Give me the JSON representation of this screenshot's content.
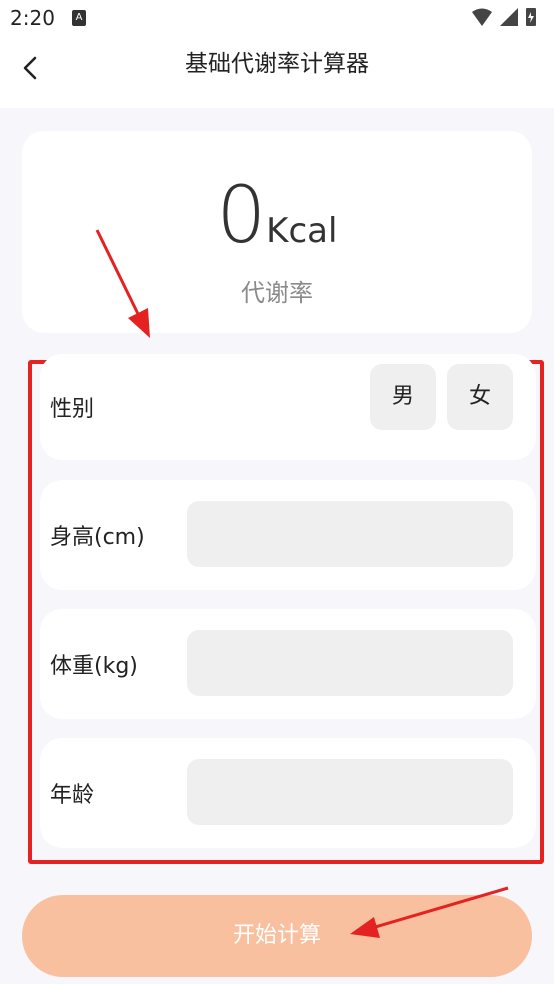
{
  "status_bar": {
    "time": "2:20",
    "notification_icon": "A",
    "icons": [
      "wifi-icon",
      "signal-icon",
      "battery-icon"
    ]
  },
  "header": {
    "title": "基础代谢率计算器",
    "back_icon": "chevron-left-icon"
  },
  "result": {
    "value": "0",
    "unit": "Kcal",
    "label": "代谢率"
  },
  "form": {
    "gender": {
      "label": "性别",
      "options": [
        "男",
        "女"
      ]
    },
    "height": {
      "label": "身高(cm)",
      "value": "",
      "placeholder": ""
    },
    "weight": {
      "label": "体重(kg)",
      "value": "",
      "placeholder": ""
    },
    "age": {
      "label": "年龄",
      "value": "",
      "placeholder": ""
    }
  },
  "actions": {
    "start_label": "开始计算"
  },
  "colors": {
    "accent_button": "#f9c09f",
    "highlight_border": "#e52222",
    "annotation_arrow": "#e52222",
    "page_background": "#f6f6fb",
    "input_background": "#efefef"
  }
}
